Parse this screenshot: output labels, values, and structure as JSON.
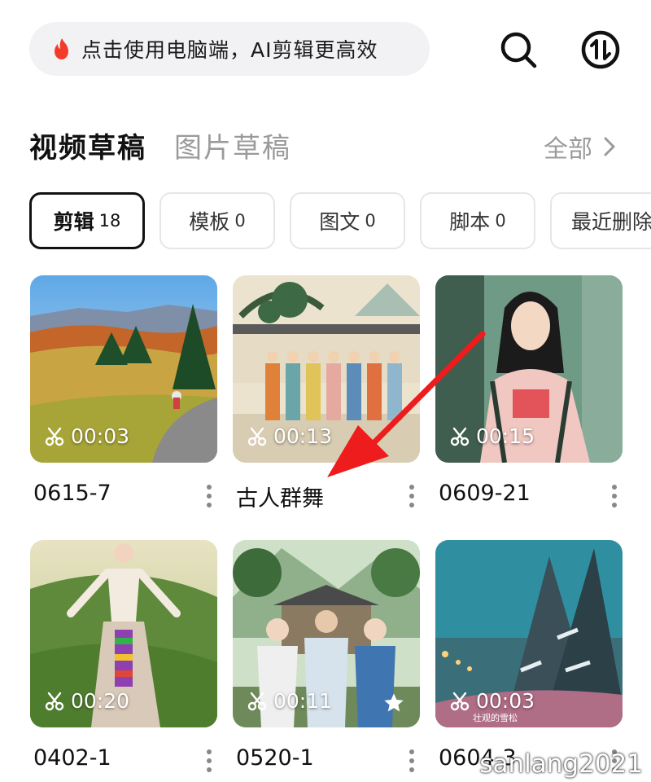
{
  "search": {
    "text": "点击使用电脑端，AI剪辑更高效"
  },
  "tabs": {
    "active": "视频草稿",
    "inactive": "图片草稿",
    "all_label": "全部"
  },
  "chips": [
    {
      "label": "剪辑",
      "count": "18",
      "active": true
    },
    {
      "label": "模板",
      "count": "0"
    },
    {
      "label": "图文",
      "count": "0"
    },
    {
      "label": "脚本",
      "count": "0"
    },
    {
      "label": "最近删除",
      "count": ""
    }
  ],
  "drafts": [
    {
      "title": "0615-7",
      "duration": "00:03"
    },
    {
      "title": "古人群舞",
      "duration": "00:13"
    },
    {
      "title": "0609-21",
      "duration": "00:15"
    },
    {
      "title": "0402-1",
      "duration": "00:20"
    },
    {
      "title": "0520-1",
      "duration": "00:11",
      "starred": true
    },
    {
      "title": "0604-3",
      "duration": "00:03",
      "caption": "壮观的雪松"
    }
  ],
  "watermark": "sanlang2021",
  "colors": {
    "accent_flame": "#f23c2b",
    "annotation_arrow": "#ee1c1c"
  }
}
